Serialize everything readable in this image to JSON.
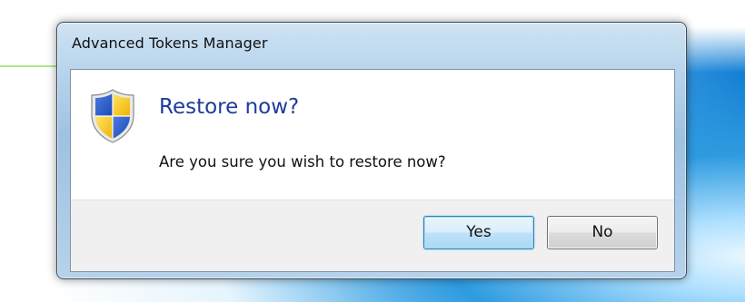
{
  "window": {
    "title": "Advanced Tokens Manager"
  },
  "dialog": {
    "icon": "security-shield-icon",
    "main_instruction": "Restore now?",
    "message": "Are you sure you wish to restore now?"
  },
  "buttons": {
    "yes_label": "Yes",
    "no_label": "No"
  },
  "colors": {
    "instruction_text": "#1d3b9a",
    "default_button_border": "#3c7fb1",
    "footer_background": "#f0f0f0"
  }
}
